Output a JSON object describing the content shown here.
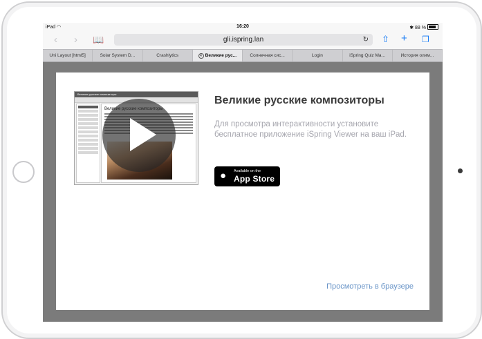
{
  "status": {
    "device": "iPad",
    "time": "16:20",
    "battery": "88 %"
  },
  "toolbar": {
    "url": "gli.ispring.lan"
  },
  "tabs": [
    {
      "label": "Uni Layout [html5]"
    },
    {
      "label": "Solar System D..."
    },
    {
      "label": "Crashlytics"
    },
    {
      "label": "Великие рус..."
    },
    {
      "label": "Солнечная сис..."
    },
    {
      "label": "Login"
    },
    {
      "label": "iSpring Quiz Ma..."
    },
    {
      "label": "История олим..."
    }
  ],
  "content": {
    "title": "Великие русские композиторы",
    "description": "Для просмотра интерактивности установите бесплатное приложение iSpring Viewer на ваш iPad.",
    "appstore": {
      "small": "Available on the",
      "big": "App Store"
    },
    "browser_link": "Просмотреть в браузере",
    "thumb": {
      "heading": "Великие русские композиторы",
      "window_title": "Великие русские композиторы"
    }
  }
}
